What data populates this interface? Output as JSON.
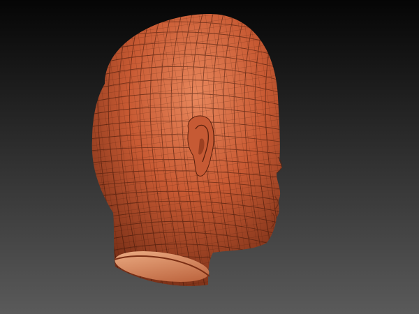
{
  "viewport": {
    "background_top": "#050505",
    "background_bottom": "#5a5a5a",
    "model": {
      "name": "head-sculpt",
      "shading": "polyframe-wireframe",
      "base_color": "#c85a33",
      "highlight_color": "#e8875c",
      "shadow_color": "#6b2812",
      "wire_color": "#3a1408"
    }
  }
}
